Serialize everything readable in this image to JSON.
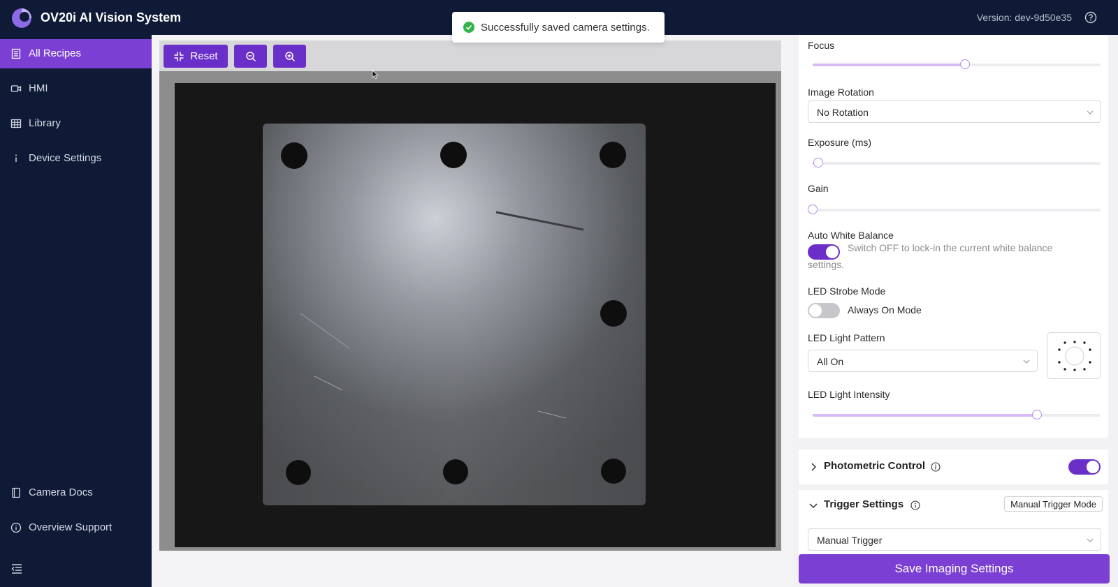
{
  "app": {
    "title": "OV20i AI Vision System",
    "version": "Version: dev-9d50e35"
  },
  "toast": {
    "message": "Successfully saved camera settings."
  },
  "sidebar": {
    "items": [
      {
        "label": "All Recipes",
        "icon": "recipes-list-icon",
        "active": true
      },
      {
        "label": "HMI",
        "icon": "video-camera-icon",
        "active": false
      },
      {
        "label": "Library",
        "icon": "grid-table-icon",
        "active": false
      },
      {
        "label": "Device Settings",
        "icon": "info-icon",
        "active": false
      }
    ],
    "bottom_items": [
      {
        "label": "Camera Docs",
        "icon": "book-icon"
      },
      {
        "label": "Overview Support",
        "icon": "info-circle-icon"
      }
    ]
  },
  "toolbar": {
    "reset_label": "Reset"
  },
  "settings": {
    "focus": {
      "label": "Focus",
      "value_fraction": 0.53
    },
    "image_rotation": {
      "label": "Image Rotation",
      "value": "No Rotation"
    },
    "exposure": {
      "label": "Exposure (ms)",
      "value_fraction": 0.02
    },
    "gain": {
      "label": "Gain",
      "value_fraction": 0.0
    },
    "auto_white_balance": {
      "label": "Auto White Balance",
      "enabled": true,
      "help": "Switch OFF to lock-in the current white balance",
      "help_cont": "settings."
    },
    "led_strobe_mode": {
      "label": "LED Strobe Mode",
      "enabled": false,
      "value": "Always On Mode"
    },
    "led_light_pattern": {
      "label": "LED Light Pattern",
      "value": "All On"
    },
    "led_light_intensity": {
      "label": "LED Light Intensity",
      "value_fraction": 0.78
    }
  },
  "photometric": {
    "title": "Photometric Control",
    "enabled": true,
    "expanded": false
  },
  "trigger": {
    "title": "Trigger Settings",
    "mode_badge": "Manual Trigger Mode",
    "value": "Manual Trigger",
    "expanded": true
  },
  "save_button": "Save Imaging Settings",
  "colors": {
    "header_bg": "#0e1a36",
    "accent": "#7b3fd4",
    "success": "#2fb34a"
  }
}
